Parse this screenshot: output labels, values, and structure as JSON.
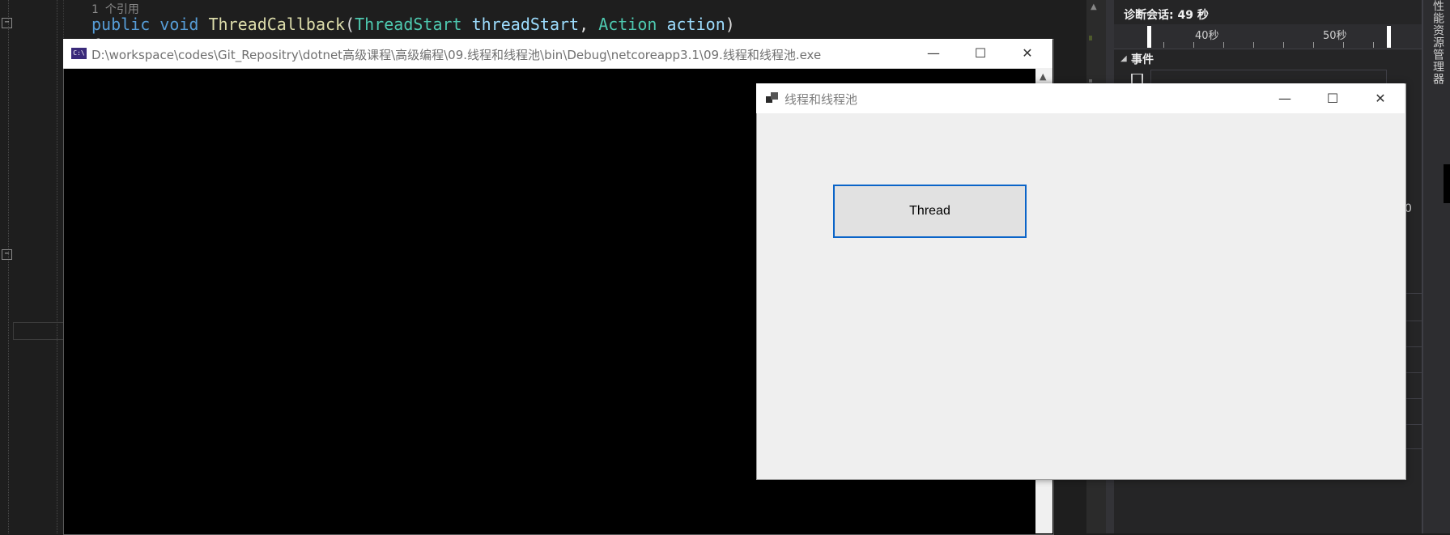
{
  "editor": {
    "reference_count": "1 个引用",
    "code": {
      "kw_public": "public",
      "kw_void": "void",
      "method": "ThreadCallback",
      "paren_open": "(",
      "type1": "ThreadStart",
      "param1": "threadStart",
      "comma": ",",
      "type2": "Action",
      "param2": "action",
      "paren_close": ")"
    },
    "brace": "{"
  },
  "diagnostics": {
    "session_label": "诊断会话: 49 秒",
    "timeline_ticks": [
      "40秒",
      "50秒"
    ],
    "events_title": "事件",
    "right_digit": "0"
  },
  "tool_strip": {
    "label": "性能资源管理器"
  },
  "console_window": {
    "icon_text": "C:\\",
    "title": "D:\\workspace\\codes\\Git_Repositry\\dotnet高级课程\\高级编程\\09.线程和线程池\\bin\\Debug\\netcoreapp3.1\\09.线程和线程池.exe",
    "minimize_glyph": "—",
    "maximize_glyph": "☐",
    "close_glyph": "✕"
  },
  "form_window": {
    "title": "线程和线程池",
    "minimize_glyph": "—",
    "maximize_glyph": "☐",
    "close_glyph": "✕",
    "thread_button_label": "Thread"
  },
  "colors": {
    "editor_bg": "#1e1e1e",
    "keyword": "#569cd6",
    "method": "#dcdcaa",
    "type": "#4ec9b0",
    "button_focus_border": "#0a64c8"
  }
}
